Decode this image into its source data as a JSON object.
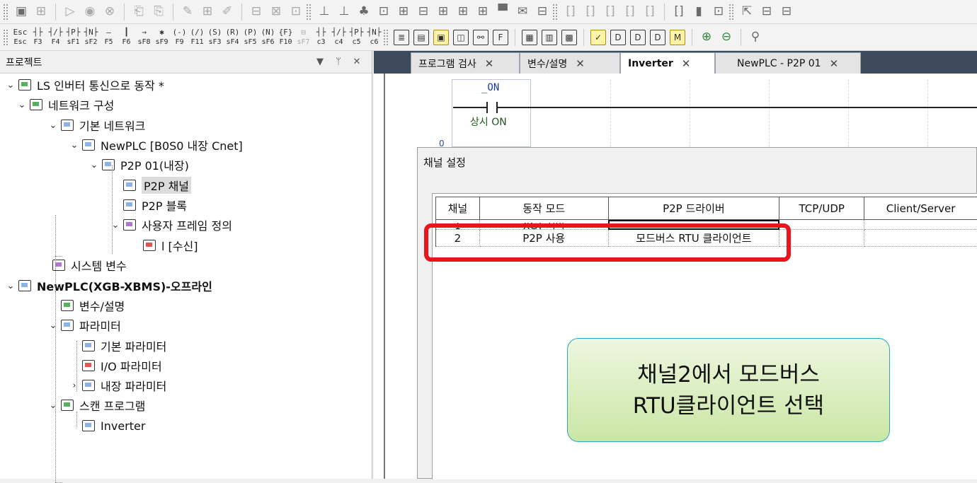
{
  "toolbar_row2_keys": [
    {
      "sym": "Esc",
      "label": "Esc",
      "dim": false
    },
    {
      "sym": "┤├",
      "label": "F3",
      "dim": false
    },
    {
      "sym": "┤/├",
      "label": "F4",
      "dim": false
    },
    {
      "sym": "┤P├",
      "label": "sF1",
      "dim": false
    },
    {
      "sym": "┤N├",
      "label": "sF2",
      "dim": false
    },
    {
      "sym": "—",
      "label": "F5",
      "dim": false
    },
    {
      "sym": "┃",
      "label": "F6",
      "dim": false
    },
    {
      "sym": "→",
      "label": "sF8",
      "dim": false
    },
    {
      "sym": "✱",
      "label": "sF9",
      "dim": false
    },
    {
      "sym": "(-)",
      "label": "F9",
      "dim": false
    },
    {
      "sym": "(/)",
      "label": "F11",
      "dim": false
    },
    {
      "sym": "(S)",
      "label": "sF3",
      "dim": false
    },
    {
      "sym": "(R)",
      "label": "sF4",
      "dim": false
    },
    {
      "sym": "(P)",
      "label": "sF5",
      "dim": false
    },
    {
      "sym": "(N)",
      "label": "sF6",
      "dim": false
    },
    {
      "sym": "{F}",
      "label": "F10",
      "dim": false
    },
    {
      "sym": "⊟",
      "label": "sF7",
      "dim": true
    },
    {
      "sym": "┤├",
      "label": "c3",
      "dim": false
    },
    {
      "sym": "┤/├",
      "label": "c4",
      "dim": false
    },
    {
      "sym": "┤P├",
      "label": "c5",
      "dim": false
    },
    {
      "sym": "┤N├",
      "label": "c6",
      "dim": false
    }
  ],
  "project_panel": {
    "title": "프로젝트",
    "controls": [
      "▼",
      "ᛘ",
      "✕"
    ],
    "tree": [
      {
        "label": "LS 인버터 통신으로 동작 *",
        "expander": "⌄",
        "bold": false
      },
      {
        "label": "네트워크 구성",
        "expander": "⌄",
        "bold": false
      },
      {
        "label": "기본 네트워크",
        "expander": "⌄",
        "bold": false
      },
      {
        "label": "NewPLC [B0S0 내장 Cnet]",
        "expander": "⌄",
        "bold": false
      },
      {
        "label": "P2P 01(내장)",
        "expander": "⌄",
        "bold": false
      },
      {
        "label": "P2P 채널",
        "expander": "",
        "bold": false
      },
      {
        "label": "P2P 블록",
        "expander": "",
        "bold": false
      },
      {
        "label": "사용자 프레임 정의",
        "expander": "⌄",
        "bold": false
      },
      {
        "label": "l [수신]",
        "expander": "",
        "bold": false
      },
      {
        "label": "시스템 변수",
        "expander": "",
        "bold": false
      },
      {
        "label": "NewPLC(XGB-XBMS)-오프라인",
        "expander": "⌄",
        "bold": true
      },
      {
        "label": "변수/설명",
        "expander": "",
        "bold": false
      },
      {
        "label": "파라미터",
        "expander": "⌄",
        "bold": false
      },
      {
        "label": "기본 파라미터",
        "expander": "",
        "bold": false
      },
      {
        "label": "I/O 파라미터",
        "expander": "",
        "bold": false
      },
      {
        "label": "내장 파라미터",
        "expander": "›",
        "bold": false
      },
      {
        "label": "스캔 프로그램",
        "expander": "⌄",
        "bold": false
      },
      {
        "label": "Inverter",
        "expander": "",
        "bold": false
      }
    ]
  },
  "tabs": [
    {
      "label": "프로그램 검사",
      "close": "✕"
    },
    {
      "label": "변수/설명",
      "close": "✕"
    },
    {
      "label": "Inverter",
      "close": "✕"
    },
    {
      "label": "NewPLC - P2P 01",
      "close": "✕"
    }
  ],
  "ladder": {
    "contact_name": "_ON",
    "contact_desc": "상시 ON",
    "row_number": "0"
  },
  "dialog": {
    "title": "채널 설정",
    "columns": [
      "채널",
      "동작 모드",
      "P2P 드라이버",
      "TCP/UDP",
      "Client/Server"
    ],
    "rows": [
      {
        "channel": "1",
        "mode": "XGT 서버",
        "driver": "",
        "tcp": "",
        "cs": ""
      },
      {
        "channel": "2",
        "mode": "P2P 사용",
        "driver": "모드버스 RTU 클라이언트",
        "tcp": "",
        "cs": ""
      }
    ]
  },
  "callout": {
    "line1": "채널2에서 모드버스",
    "line2": "RTU클라이언트 선택"
  },
  "colors": {
    "highlight": "#e8141e",
    "callout_border": "#2aa8c8",
    "tab_strip": "#3c4a5c"
  }
}
